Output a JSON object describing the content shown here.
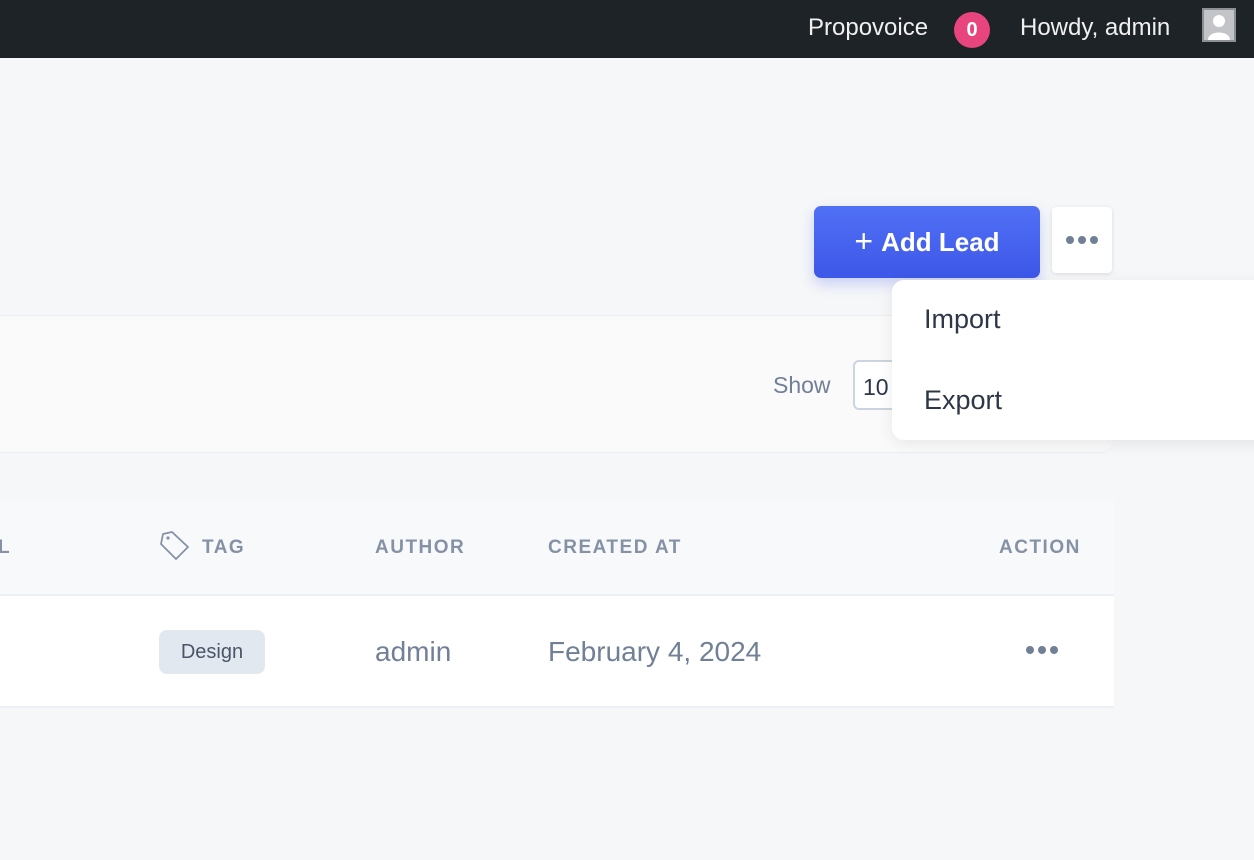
{
  "admin_bar": {
    "brand": "Propovoice",
    "notification_count": "0",
    "greeting": "Howdy, admin"
  },
  "header": {
    "add_lead_label": "Add Lead",
    "add_lead_icon": "plus-icon",
    "more_icon": "more-horizontal-icon"
  },
  "more_menu": {
    "items": [
      {
        "label": "Import"
      },
      {
        "label": "Export"
      }
    ]
  },
  "filters": {
    "show_label": "Show",
    "per_page": "10"
  },
  "table": {
    "columns": [
      {
        "label": "L",
        "partial": true
      },
      {
        "label": "TAG",
        "icon": "tag-icon"
      },
      {
        "label": "AUTHOR"
      },
      {
        "label": "CREATED AT"
      },
      {
        "label": "ACTION"
      }
    ],
    "rows": [
      {
        "tag": "Design",
        "author": "admin",
        "created_at": "February 4, 2024",
        "action_icon": "more-horizontal-icon"
      }
    ]
  },
  "colors": {
    "accent": "#4562f0",
    "badge": "#e8457e",
    "admin_bar": "#1d2327"
  }
}
